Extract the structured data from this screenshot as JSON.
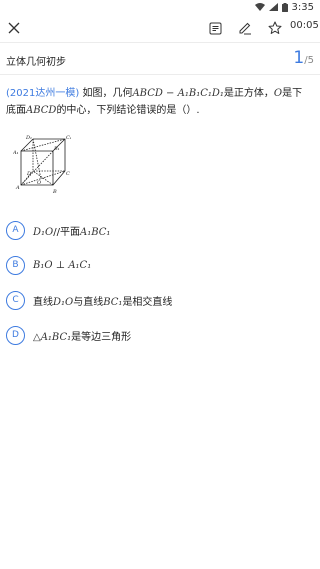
{
  "status_bar": {
    "time": "3:35",
    "icons": [
      "wifi-icon",
      "signal-icon",
      "battery-icon"
    ]
  },
  "toolbar": {
    "close_icon": "close-icon",
    "answer_card_icon": "answer-card-icon",
    "edit_icon": "pencil-icon",
    "favorite_icon": "star-outline-icon",
    "timer": "00:05"
  },
  "section": {
    "title": "立体几何初步",
    "current": "1",
    "separator": "/",
    "total": "5"
  },
  "question": {
    "source": "(2021达州一模)",
    "text_1": "如图，几何",
    "math_1": "ABCD − A₁B₁C₁D₁",
    "text_2": "是正方体，",
    "math_2": "O",
    "text_3": "是下底面",
    "math_3": "ABCD",
    "text_4": "的中心，下列结论错误的是（）."
  },
  "figure": {
    "labels": [
      "D₁",
      "C₁",
      "A₁",
      "B₁",
      "D",
      "C",
      "O",
      "A",
      "B"
    ]
  },
  "options": [
    {
      "letter": "A",
      "math": "D₁O",
      "text": "//平面",
      "math_2": "A₁BC₁",
      "text_2": ""
    },
    {
      "letter": "B",
      "math": "B₁O ⊥ A₁C₁",
      "text": "",
      "math_2": "",
      "text_2": ""
    },
    {
      "letter": "C",
      "math": "",
      "text": "直线",
      "math_2": "D₁O",
      "text_2": "与直线",
      "math_3": "BC₁",
      "text_3": "是相交直线"
    },
    {
      "letter": "D",
      "math": "△A₁BC₁",
      "text": "是等边三角形",
      "math_2": "",
      "text_2": ""
    }
  ],
  "colors": {
    "accent": "#3e7be0",
    "text": "#222222",
    "divider": "#ececec"
  }
}
